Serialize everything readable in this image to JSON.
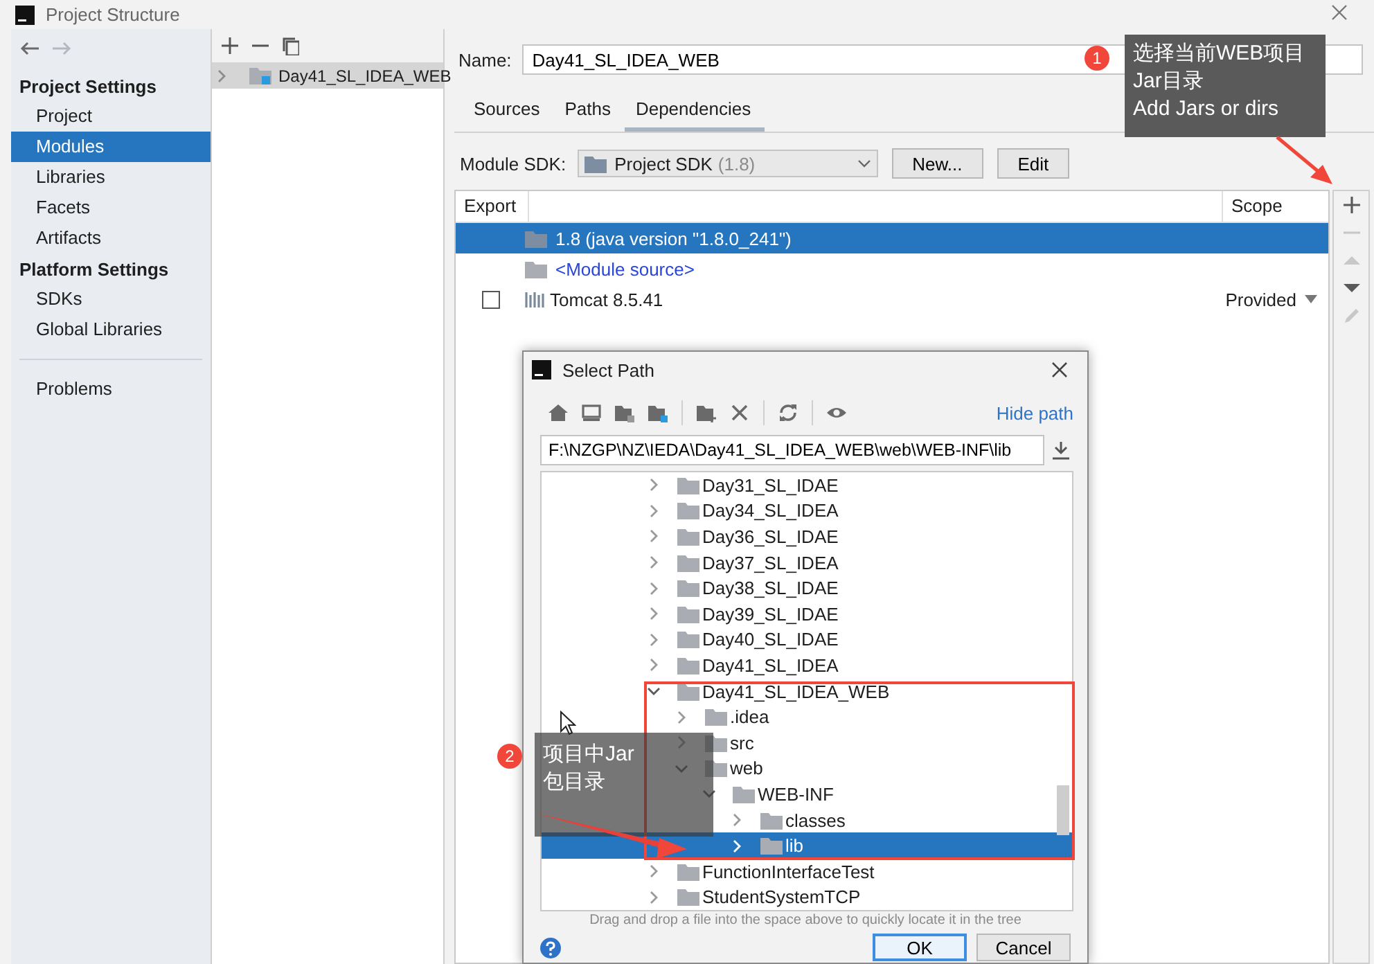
{
  "window": {
    "title": "Project Structure"
  },
  "nav": {
    "back": {
      "disabled": false
    },
    "forward": {
      "disabled": true
    }
  },
  "sidebar": {
    "sections": [
      {
        "heading": "Project Settings",
        "items": [
          {
            "label": "Project",
            "selected": false
          },
          {
            "label": "Modules",
            "selected": true
          },
          {
            "label": "Libraries",
            "selected": false
          },
          {
            "label": "Facets",
            "selected": false
          },
          {
            "label": "Artifacts",
            "selected": false
          }
        ]
      },
      {
        "heading": "Platform Settings",
        "items": [
          {
            "label": "SDKs",
            "selected": false
          },
          {
            "label": "Global Libraries",
            "selected": false
          }
        ]
      }
    ],
    "footer_items": [
      {
        "label": "Problems",
        "selected": false
      }
    ]
  },
  "modules": {
    "tree": [
      {
        "label": "Day41_SL_IDEA_WEB",
        "expanded": false,
        "selected": true
      }
    ]
  },
  "editor": {
    "name_label": "Name:",
    "name_value": "Day41_SL_IDEA_WEB",
    "tabs": [
      {
        "label": "Sources",
        "selected": false
      },
      {
        "label": "Paths",
        "selected": false
      },
      {
        "label": "Dependencies",
        "selected": true
      }
    ],
    "sdk_label": "Module SDK:",
    "sdk_value": "Project SDK",
    "sdk_version": "(1.8)",
    "buttons": [
      "New...",
      "Edit"
    ],
    "table": {
      "columns": [
        "Export",
        "Scope"
      ],
      "rows": [
        {
          "kind": "sdk",
          "name": "1.8 (java version \"1.8.0_241\")",
          "selected": true
        },
        {
          "kind": "source",
          "name": "<Module source>",
          "selected": false
        },
        {
          "kind": "library",
          "name": "Tomcat 8.5.41",
          "selected": false,
          "exported": false,
          "scope": "Provided"
        }
      ]
    },
    "tools": [
      {
        "kind": "add",
        "disabled": false
      },
      {
        "kind": "remove",
        "disabled": true
      },
      {
        "kind": "up",
        "disabled": true
      },
      {
        "kind": "down",
        "disabled": false
      },
      {
        "kind": "edit",
        "disabled": true
      }
    ]
  },
  "dialog": {
    "title": "Select Path",
    "hide_path_link": "Hide path",
    "path": "F:\\NZGP\\NZ\\IEDA\\Day41_SL_IDEA_WEB\\web\\WEB-INF\\lib",
    "tree": [
      {
        "label": "Day31_SL_IDAE",
        "expanded": false,
        "selected": false
      },
      {
        "label": "Day34_SL_IDEA",
        "expanded": false,
        "selected": false
      },
      {
        "label": "Day36_SL_IDAE",
        "expanded": false,
        "selected": false
      },
      {
        "label": "Day37_SL_IDEA",
        "expanded": false,
        "selected": false
      },
      {
        "label": "Day38_SL_IDAE",
        "expanded": false,
        "selected": false
      },
      {
        "label": "Day39_SL_IDAE",
        "expanded": false,
        "selected": false
      },
      {
        "label": "Day40_SL_IDAE",
        "expanded": false,
        "selected": false
      },
      {
        "label": "Day41_SL_IDEA",
        "expanded": false,
        "selected": false
      },
      {
        "label": "Day41_SL_IDEA_WEB",
        "expanded": true,
        "selected": false,
        "children": [
          {
            "label": ".idea",
            "expanded": false,
            "selected": false
          },
          {
            "label": "src",
            "expanded": false,
            "selected": false
          },
          {
            "label": "web",
            "expanded": true,
            "selected": false,
            "children": [
              {
                "label": "WEB-INF",
                "expanded": true,
                "selected": false,
                "children": [
                  {
                    "label": "classes",
                    "expanded": false,
                    "selected": false
                  },
                  {
                    "label": "lib",
                    "expanded": false,
                    "selected": true
                  }
                ]
              }
            ]
          }
        ]
      },
      {
        "label": "FunctionInterfaceTest",
        "expanded": false,
        "selected": false
      },
      {
        "label": "StudentSystemTCP",
        "expanded": false,
        "selected": false
      }
    ],
    "hint": "Drag and drop a file into the space above to quickly locate it in the tree",
    "buttons": [
      {
        "label": "OK",
        "default": true
      },
      {
        "label": "Cancel",
        "default": false
      }
    ]
  },
  "annotations": [
    {
      "number": "1",
      "lines": [
        "选择当前WEB项目",
        "Jar目录",
        "Add Jars or dirs"
      ]
    },
    {
      "number": "2",
      "lines": [
        "项目中Jar",
        "包目录"
      ]
    }
  ]
}
